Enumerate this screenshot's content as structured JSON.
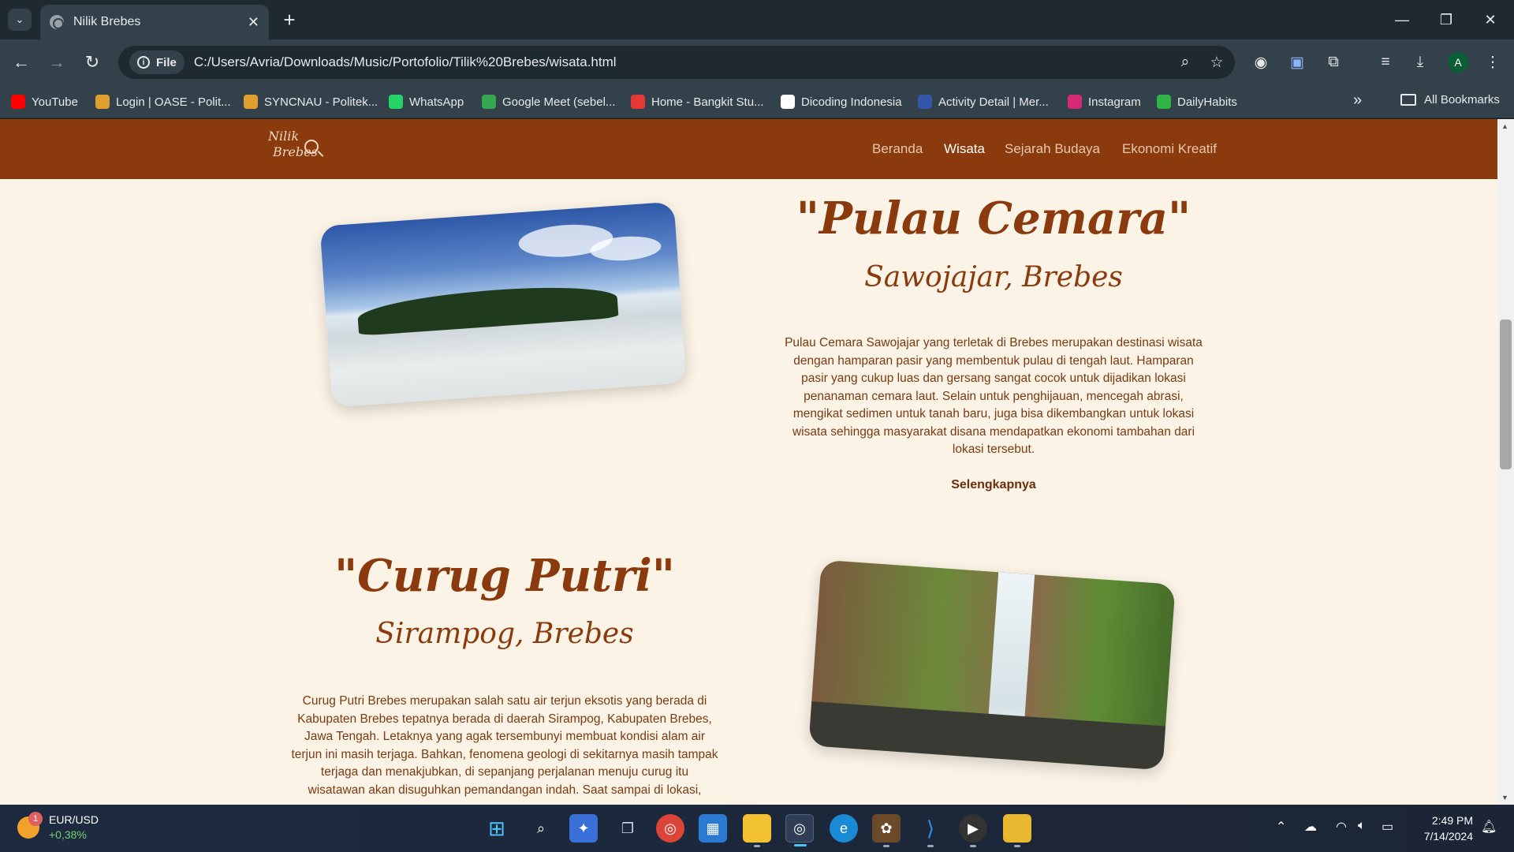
{
  "browser": {
    "tab_title": "Nilik Brebes",
    "new_tab_symbol": "+",
    "chip_label": "File",
    "url": "C:/Users/Avria/Downloads/Music/Portofolio/Tilik%20Brebes/wisata.html",
    "profile_initial": "A",
    "bookmarks": [
      {
        "label": "YouTube",
        "color": "#ff0000"
      },
      {
        "label": "Login | OASE - Polit...",
        "color": "#e0a030"
      },
      {
        "label": "SYNCNAU - Politek...",
        "color": "#e0a030"
      },
      {
        "label": "WhatsApp",
        "color": "#25d366"
      },
      {
        "label": "Google Meet (sebel...",
        "color": "#34a853"
      },
      {
        "label": "Home - Bangkit Stu...",
        "color": "#e53935"
      },
      {
        "label": "Dicoding Indonesia",
        "color": "#ffffff"
      },
      {
        "label": "Activity Detail | Mer...",
        "color": "#3355aa"
      },
      {
        "label": "Instagram",
        "color": "#d62976"
      },
      {
        "label": "DailyHabits",
        "color": "#2fb344"
      }
    ],
    "all_bookmarks": "All Bookmarks",
    "more_symbol": "»"
  },
  "site": {
    "logo_line1": "Nilik",
    "logo_line2": "Brebes",
    "nav": [
      "Beranda",
      "Wisata",
      "Sejarah Budaya",
      "Ekonomi Kreatif"
    ],
    "active_nav": "Wisata",
    "items": [
      {
        "title": "\"Pulau Cemara\"",
        "location": "Sawojajar, Brebes",
        "description_lines": [
          "Pulau Cemara Sawojajar yang terletak di Brebes merupakan destinasi wisata",
          "dengan hamparan pasir yang membentuk pulau di tengah laut. Hamparan",
          "pasir yang cukup luas dan gersang sangat cocok untuk dijadikan lokasi",
          "penanaman cemara laut. Selain untuk penghijauan, mencegah abrasi,",
          "mengikat sedimen untuk tanah baru, juga bisa dikembangkan untuk lokasi",
          "wisata sehingga masyarakat disana mendapatkan ekonomi tambahan dari",
          "lokasi tersebut."
        ],
        "more": "Selengkapnya"
      },
      {
        "title": "\"Curug Putri\"",
        "location": "Sirampog, Brebes",
        "description_lines": [
          "Curug Putri Brebes merupakan salah satu air terjun eksotis yang berada di",
          "Kabupaten Brebes tepatnya berada di daerah Sirampog, Kabupaten Brebes,",
          "Jawa Tengah. Letaknya yang agak tersembunyi membuat kondisi alam air",
          "terjun ini masih terjaga. Bahkan, fenomena geologi di sekitarnya masih tampak",
          "terjaga dan menakjubkan, di sepanjang perjalanan menuju curug itu",
          "wisatawan akan disuguhkan pemandangan indah. Saat sampai di lokasi,"
        ]
      }
    ]
  },
  "taskbar": {
    "widget_badge": "1",
    "widget_title": "EUR/USD",
    "widget_change": "+0,38%",
    "time": "2:49 PM",
    "date": "7/14/2024"
  }
}
